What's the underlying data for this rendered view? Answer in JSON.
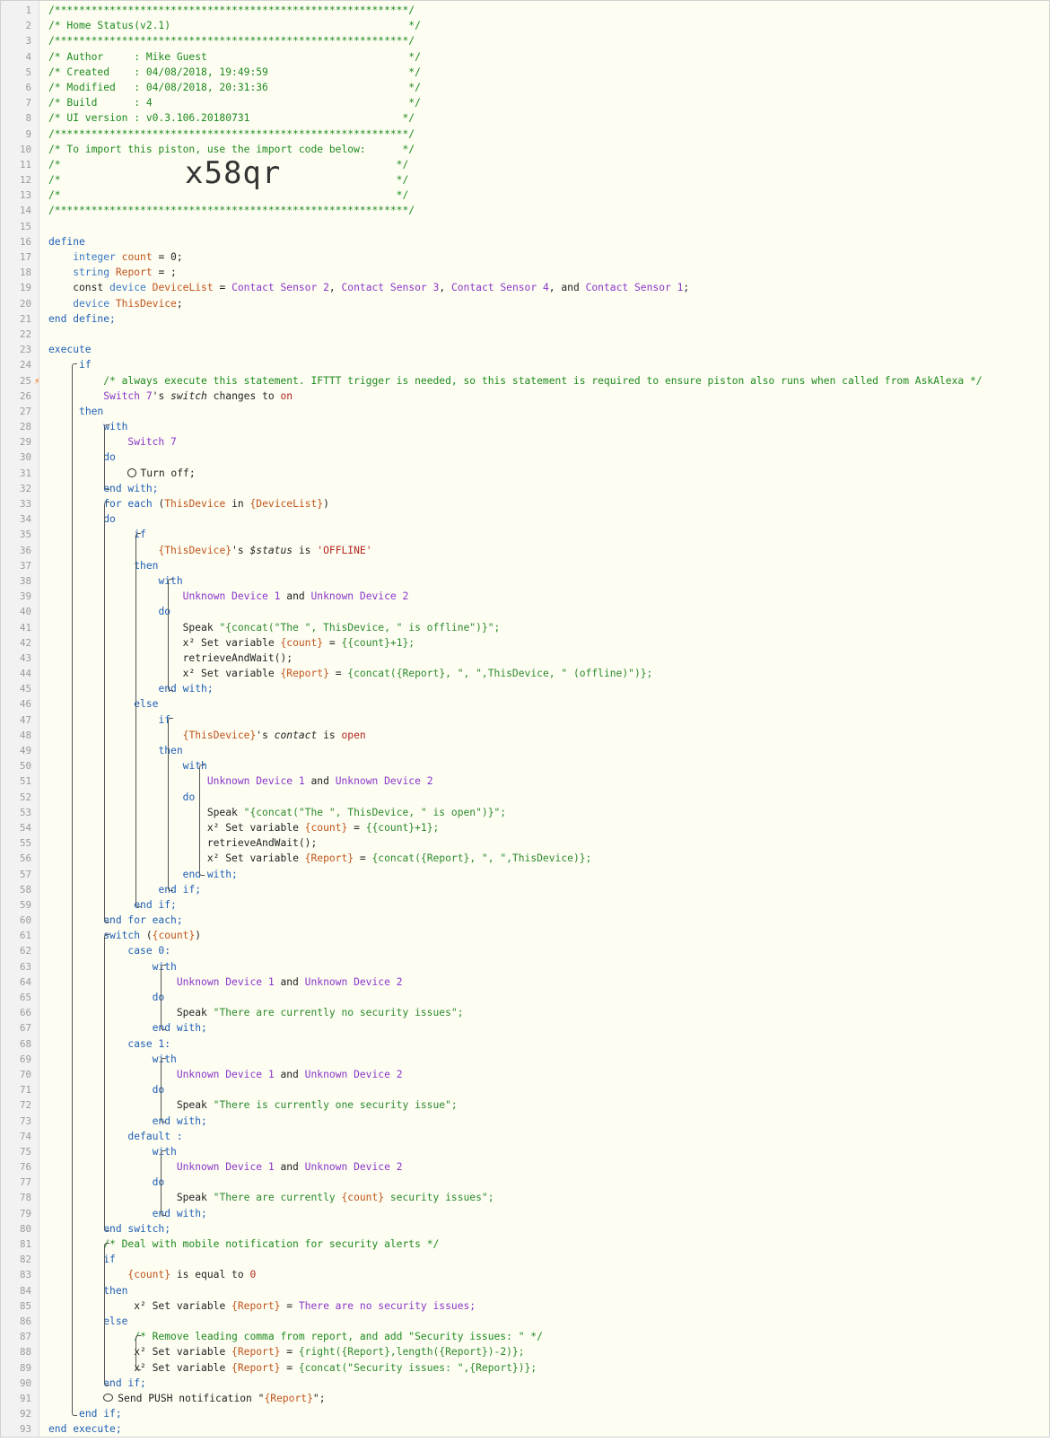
{
  "line_numbers": [
    "1",
    "2",
    "3",
    "4",
    "5",
    "6",
    "7",
    "8",
    "9",
    "10",
    "11",
    "12",
    "13",
    "14",
    "15",
    "16",
    "17",
    "18",
    "19",
    "20",
    "21",
    "22",
    "23",
    "24",
    "25",
    "26",
    "27",
    "28",
    "29",
    "30",
    "31",
    "32",
    "33",
    "34",
    "35",
    "36",
    "37",
    "38",
    "39",
    "40",
    "41",
    "42",
    "43",
    "44",
    "45",
    "46",
    "47",
    "48",
    "49",
    "50",
    "51",
    "52",
    "53",
    "54",
    "55",
    "56",
    "57",
    "58",
    "59",
    "60",
    "61",
    "62",
    "63",
    "64",
    "65",
    "66",
    "67",
    "68",
    "69",
    "70",
    "71",
    "72",
    "73",
    "74",
    "75",
    "76",
    "77",
    "78",
    "79",
    "80",
    "81",
    "82",
    "83",
    "84",
    "85",
    "86",
    "87",
    "88",
    "89",
    "90",
    "91",
    "92",
    "93"
  ],
  "header": {
    "stars": "/**********************************************************/",
    "title": "/* Home Status(v2.1)                                       */",
    "author": "/* Author     : Mike Guest                                 */",
    "created": "/* Created    : 04/08/2018, 19:49:59                       */",
    "modified": "/* Modified   : 04/08/2018, 20:31:36                       */",
    "build": "/* Build      : 4                                          */",
    "ui_version": "/* UI version : v0.3.106.20180731                         */",
    "import_hint": "/* To import this piston, use the import code below:      */",
    "blank_open": "/*",
    "blank_close": "*/",
    "import_code": "x58qr"
  },
  "define": {
    "define": "define",
    "integer": "integer",
    "count": "count",
    "eq_zero": " = 0;",
    "string": "string",
    "report": "Report",
    "eq_empty": " = ;",
    "const": "const",
    "device": "device",
    "devicelist": "DeviceList",
    "eq": " = ",
    "cs2": "Contact Sensor 2",
    "cs3": "Contact Sensor 3",
    "cs4": "Contact Sensor 4",
    "cs1": "Contact Sensor 1",
    "comma": ", ",
    "and": ", and ",
    "semi": ";",
    "thisdevice": "ThisDevice",
    "end_define": "end define;"
  },
  "execute": {
    "execute": "execute",
    "if": "if",
    "comment1": "/* always execute this statement. IFTTT trigger is needed, so this statement is required to ensure piston also runs when called from AskAlexa */",
    "switch7": "Switch 7",
    "s_switch": "'s ",
    "switch_attr": "switch",
    "changes_to": " changes to ",
    "on": "on",
    "then": "then",
    "with": "with",
    "do": "do",
    "turn_off": "Turn off;",
    "end_with": "end with;",
    "for_each": "for each",
    "for_args_open": " (",
    "in": " in ",
    "devicelist_var": "{DeviceList}",
    "close_paren": ")",
    "thisdevice_var": "{ThisDevice}",
    "s_status": "'s ",
    "status_attr": "$status",
    "is": " is ",
    "offline": "'OFFLINE'",
    "ud1": "Unknown Device 1",
    "and_word": " and ",
    "ud2": "Unknown Device 2",
    "speak": "Speak ",
    "speak_offline": "\"{concat(\"The \", ThisDevice, \" is offline\")}\";",
    "x2": "x²",
    "set_variable": " Set variable ",
    "count_var": "{count}",
    "count_incr": "{{count}+1};",
    "retrieve": "retrieveAndWait();",
    "report_var": "{Report}",
    "report_offline": "{concat({Report}, \", \",ThisDevice, \" (offline)\")};",
    "else": "else",
    "contact_attr": "contact",
    "open": "open",
    "speak_open": "\"{concat(\"The \", ThisDevice, \" is open\")}\";",
    "report_open": "{concat({Report}, \", \",ThisDevice)};",
    "end_if": "end if;",
    "end_for_each": "end for each;",
    "switch": "switch",
    "switch_args_open": " (",
    "case0": "case 0:",
    "speak_none": "\"There are currently no security issues\";",
    "case1": "case 1:",
    "speak_one": "\"There is currently one security issue\";",
    "default": "default :",
    "speak_count_a": "\"There are currently ",
    "speak_count_b": " security issues\";",
    "end_switch": "end switch;",
    "comment2": "/* Deal with mobile notification for security alerts */",
    "is_equal_to": " is equal to ",
    "zero": "0",
    "no_issues": "There are no security issues;",
    "comment3": "/* Remove leading comma from report, and add \"Security issues: \" */",
    "right_expr": "{right({Report},length({Report})-2)};",
    "concat_expr": "{concat(\"Security issues: \",{Report})};",
    "send_push": "Send PUSH notification ",
    "push_msg_a": "\"",
    "push_msg_b": "\";",
    "end_execute": "end execute;"
  }
}
